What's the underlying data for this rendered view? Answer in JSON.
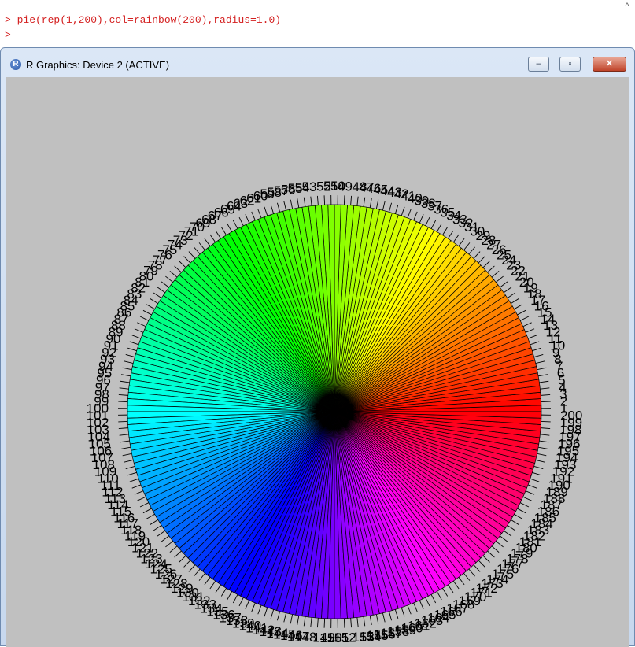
{
  "console": {
    "lines": [
      "> pie(rep(1,200),col=rainbow(200),radius=1.0)",
      ">"
    ],
    "scroll_up_glyph": "^"
  },
  "window": {
    "title": "R Graphics: Device 2 (ACTIVE)",
    "icon_letter": "R",
    "minimize_glyph": "‒",
    "maximize_glyph": "▫",
    "close_glyph": "✕",
    "background": "#c0c0c0"
  },
  "chart_data": {
    "type": "pie",
    "slices": 200,
    "values": "rep(1,200)",
    "colors": "rainbow(200)",
    "labels": [
      "1",
      "2",
      "3",
      "4",
      "5",
      "6",
      "7",
      "8",
      "9",
      "10",
      "11",
      "12",
      "13",
      "14",
      "15",
      "16",
      "17",
      "18",
      "19",
      "20",
      "21",
      "22",
      "23",
      "24",
      "25",
      "26",
      "27",
      "28",
      "29",
      "30",
      "31",
      "32",
      "33",
      "34",
      "35",
      "36",
      "37",
      "38",
      "39",
      "40",
      "41",
      "42",
      "43",
      "44",
      "45",
      "46",
      "47",
      "48",
      "49",
      "50",
      "51",
      "52",
      "53",
      "54",
      "55",
      "56",
      "57",
      "58",
      "59",
      "60",
      "61",
      "62",
      "63",
      "64",
      "65",
      "66",
      "67",
      "68",
      "69",
      "70",
      "71",
      "72",
      "73",
      "74",
      "75",
      "76",
      "77",
      "78",
      "79",
      "80",
      "81",
      "82",
      "83",
      "84",
      "85",
      "86",
      "87",
      "88",
      "89",
      "90",
      "91",
      "92",
      "93",
      "94",
      "95",
      "96",
      "97",
      "98",
      "99",
      "100",
      "101",
      "102",
      "103",
      "104",
      "105",
      "106",
      "107",
      "108",
      "109",
      "110",
      "111",
      "112",
      "113",
      "114",
      "115",
      "116",
      "117",
      "118",
      "119",
      "120",
      "121",
      "122",
      "123",
      "124",
      "125",
      "126",
      "127",
      "128",
      "129",
      "130",
      "131",
      "132",
      "133",
      "134",
      "135",
      "136",
      "137",
      "138",
      "139",
      "140",
      "141",
      "142",
      "143",
      "144",
      "145",
      "146",
      "147",
      "148",
      "149",
      "150",
      "151",
      "152",
      "153",
      "154",
      "155",
      "156",
      "157",
      "158",
      "159",
      "160",
      "161",
      "162",
      "163",
      "164",
      "165",
      "166",
      "167",
      "168",
      "169",
      "170",
      "171",
      "172",
      "173",
      "174",
      "175",
      "176",
      "177",
      "178",
      "179",
      "180",
      "181",
      "182",
      "183",
      "184",
      "185",
      "186",
      "187",
      "188",
      "189",
      "190",
      "191",
      "192",
      "193",
      "194",
      "195",
      "196",
      "197",
      "198",
      "199",
      "200"
    ],
    "radius": 1.0,
    "start": "0 degrees, counter-clockwise"
  }
}
